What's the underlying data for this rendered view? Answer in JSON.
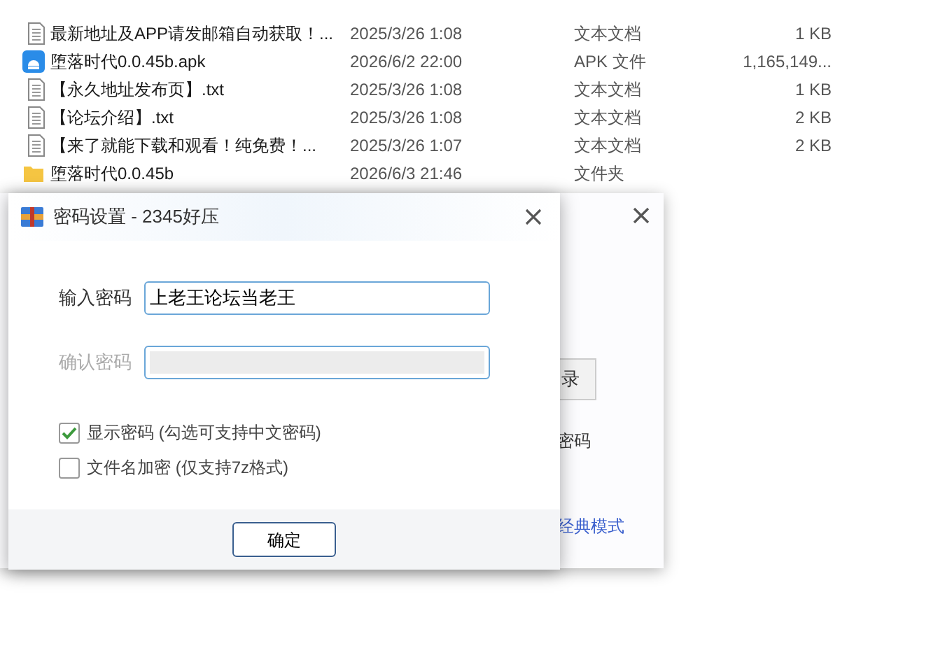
{
  "files": [
    {
      "kind": "text",
      "name": "最新地址及APP请发邮箱自动获取！...",
      "date": "2025/3/26 1:08",
      "type": "文本文档",
      "size": "1 KB"
    },
    {
      "kind": "apk",
      "name": "堕落时代0.0.45b.apk",
      "date": "2026/6/2 22:00",
      "type": "APK 文件",
      "size": "1,165,149..."
    },
    {
      "kind": "text",
      "name": "【永久地址发布页】.txt",
      "date": "2025/3/26 1:08",
      "type": "文本文档",
      "size": "1 KB"
    },
    {
      "kind": "text",
      "name": "【论坛介绍】.txt",
      "date": "2025/3/26 1:08",
      "type": "文本文档",
      "size": "2 KB"
    },
    {
      "kind": "text",
      "name": "【来了就能下载和观看！纯免费！...",
      "date": "2025/3/26 1:07",
      "type": "文本文档",
      "size": "2 KB"
    },
    {
      "kind": "folder",
      "name": "堕落时代0.0.45b",
      "date": "2026/6/3 21:46",
      "type": "文件夹"
    }
  ],
  "back_window": {
    "button_fragment": "录",
    "label_fragment": "密码",
    "link_fragment": "经典模式"
  },
  "dialog": {
    "title": "密码设置 - 2345好压",
    "fields": [
      {
        "label": "输入密码",
        "value": "上老王论坛当老王",
        "disabled": false
      },
      {
        "label": "确认密码",
        "disabled": true
      }
    ],
    "options": [
      {
        "label": "显示密码 (勾选可支持中文密码)",
        "checked": true
      },
      {
        "label": "文件名加密 (仅支持7z格式)",
        "checked": false
      }
    ],
    "ok_button": "确定"
  }
}
